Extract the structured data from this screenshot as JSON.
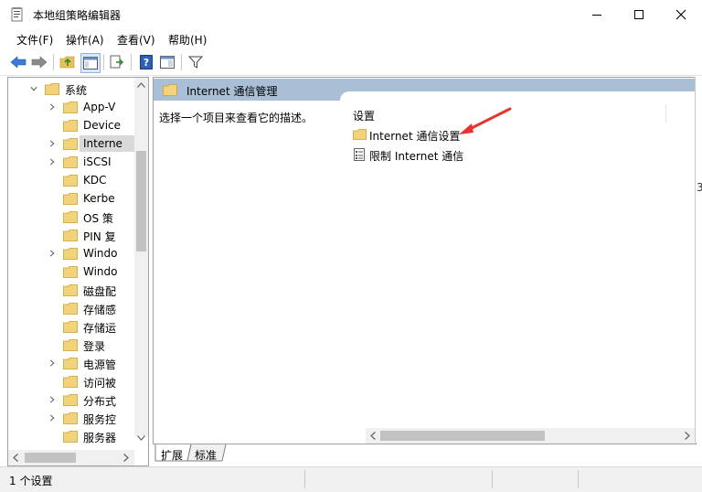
{
  "window": {
    "title": "本地组策略编辑器"
  },
  "menu": [
    {
      "label": "文件(F)"
    },
    {
      "label": "操作(A)"
    },
    {
      "label": "查看(V)"
    },
    {
      "label": "帮助(H)"
    }
  ],
  "tree": {
    "items": [
      {
        "label": "系统",
        "expanded": true
      },
      {
        "label": "App-V"
      },
      {
        "label": "Device"
      },
      {
        "label": "Interne",
        "selected": true
      },
      {
        "label": "iSCSI"
      },
      {
        "label": "KDC"
      },
      {
        "label": "Kerbe"
      },
      {
        "label": "OS 策"
      },
      {
        "label": "PIN 复"
      },
      {
        "label": "Windo"
      },
      {
        "label": "Windo"
      },
      {
        "label": "磁盘配"
      },
      {
        "label": "存储感"
      },
      {
        "label": "存储运"
      },
      {
        "label": "登录"
      },
      {
        "label": "电源管"
      },
      {
        "label": "访问被"
      },
      {
        "label": "分布式"
      },
      {
        "label": "服务控"
      },
      {
        "label": "服务器"
      }
    ]
  },
  "right": {
    "header": "Internet 通信管理",
    "description": "选择一个项目来查看它的描述。",
    "column_header": "设置",
    "rows": [
      {
        "label": "Internet 通信设置",
        "icon": "folder-icon"
      },
      {
        "label": "限制 Internet 通信",
        "icon": "policy-setting-icon"
      }
    ]
  },
  "tabs": [
    {
      "label": "扩展",
      "active": true
    },
    {
      "label": "标准"
    }
  ],
  "status": {
    "text": "1 个设置"
  },
  "background_window": {
    "fragments": [
      "3"
    ]
  },
  "colors": {
    "header_bg": "#a9bfd6",
    "folder": "#e8c15a",
    "arrow_annotation": "#e8342f"
  }
}
